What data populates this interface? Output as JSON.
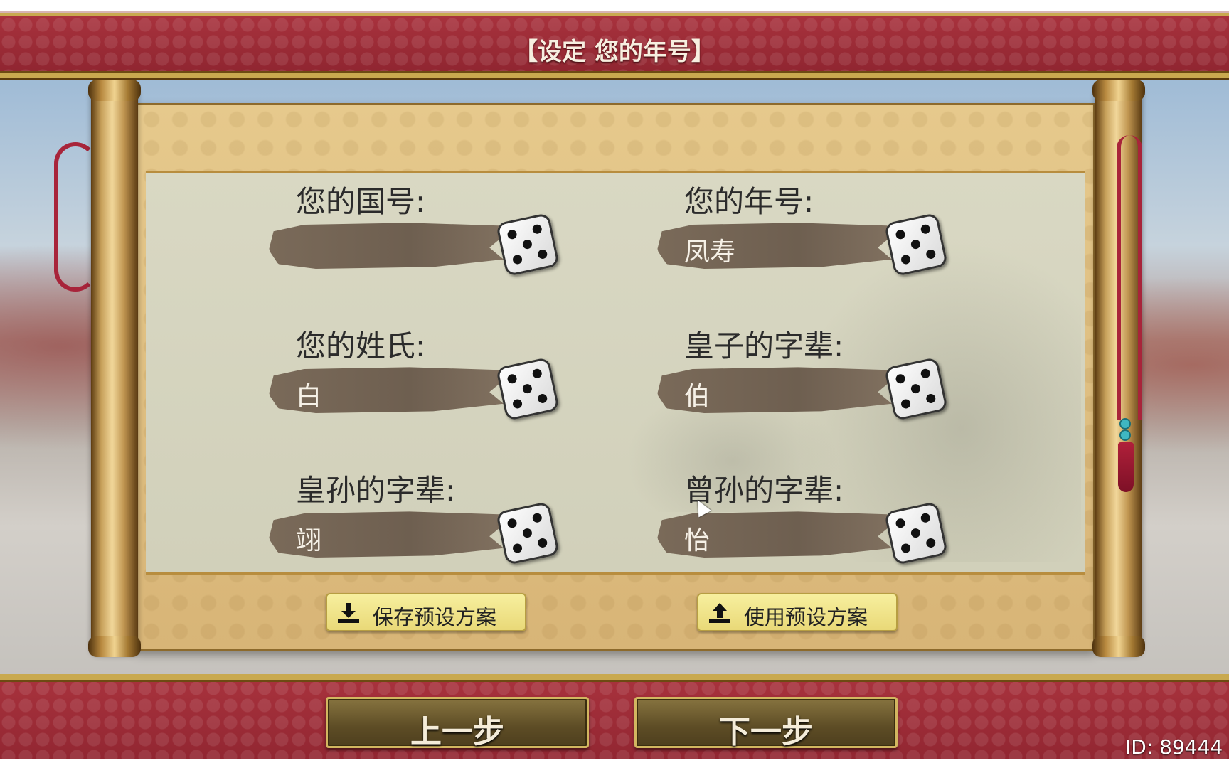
{
  "header": {
    "title": "【设定 您的年号】"
  },
  "fields": {
    "country": {
      "label": "您的国号:",
      "value": ""
    },
    "era": {
      "label": "您的年号:",
      "value": "凤寿"
    },
    "surname": {
      "label": "您的姓氏:",
      "value": "白"
    },
    "prince_generation": {
      "label": "皇子的字辈:",
      "value": "伯"
    },
    "grandson_generation": {
      "label": "皇孙的字辈:",
      "value": "翊"
    },
    "great_grandson_generation": {
      "label": "曾孙的字辈:",
      "value": "怡"
    }
  },
  "dice_icon": "dice-five-icon",
  "presets": {
    "save": {
      "label": "保存预设方案",
      "icon": "download-icon"
    },
    "use": {
      "label": "使用预设方案",
      "icon": "upload-icon"
    }
  },
  "nav": {
    "prev": "上一步",
    "next": "下一步"
  },
  "footer": {
    "id_text": "ID: 89444"
  },
  "colors": {
    "banner_red": "#9c2c36",
    "gold_trim": "#c9a94f",
    "brush_ink": "#6e5f50",
    "button_yellow": "#efe28a"
  }
}
